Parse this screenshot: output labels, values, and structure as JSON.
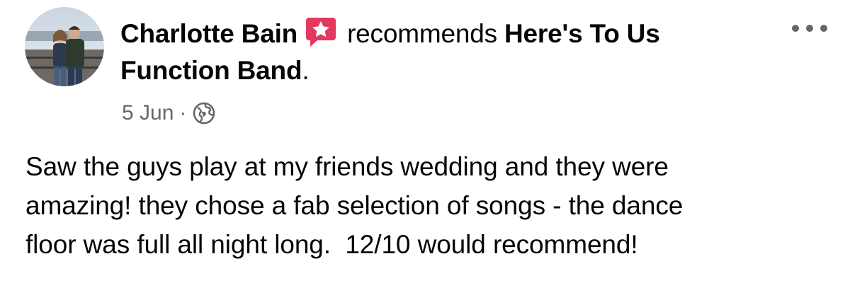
{
  "post": {
    "author": "Charlotte Bain",
    "badge_icon": "recommendation-star-icon",
    "verb": "recommends",
    "page_name": "Here's To Us Function Band",
    "page_name_suffix": ".",
    "date": "5 Jun",
    "separator": "·",
    "privacy_icon": "globe-icon",
    "more_icon": "more-options-icon",
    "text_line_1": "Saw the guys play at my friends wedding and they were",
    "text_line_2": "amazing! they chose a fab selection of songs - the dance",
    "text_line_3": "floor was full all night long.  12/10 would recommend!"
  },
  "colors": {
    "badge": "#e4395f",
    "secondary_text": "#65676b",
    "primary_text": "#050505",
    "background": "#ffffff"
  }
}
